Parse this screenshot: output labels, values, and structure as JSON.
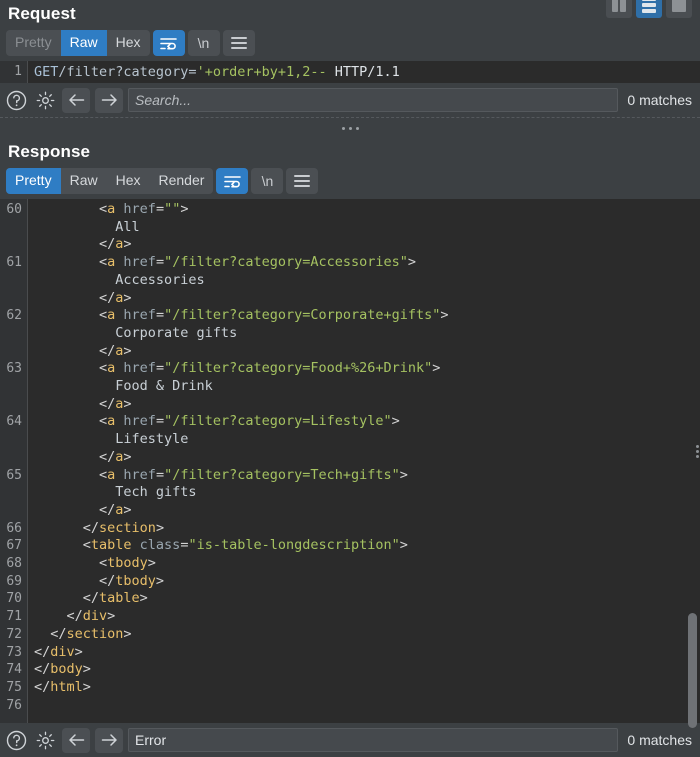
{
  "window": {
    "layout_buttons": [
      {
        "name": "layout-side-by-side",
        "icon": "columns-icon",
        "active": false
      },
      {
        "name": "layout-stacked",
        "icon": "rows-icon",
        "active": true
      },
      {
        "name": "layout-single",
        "icon": "square-icon",
        "active": false
      }
    ]
  },
  "request": {
    "title": "Request",
    "tabs": [
      {
        "label": "Pretty",
        "active": false,
        "dim": true
      },
      {
        "label": "Raw",
        "active": true,
        "dim": false
      },
      {
        "label": "Hex",
        "active": false,
        "dim": false
      }
    ],
    "wrap_icon": "word-wrap-icon",
    "newline_label": "\\n",
    "menu_icon": "hamburger-menu-icon",
    "line_number": "1",
    "line": {
      "method": "GET",
      "path": "/filter?category=",
      "payload": "'+order+by+1,2--",
      "protocol": " HTTP/1.1"
    },
    "search": {
      "help_icon": "help-circle-icon",
      "settings_icon": "gear-icon",
      "prev_icon": "arrow-left-icon",
      "next_icon": "arrow-right-icon",
      "placeholder": "Search...",
      "value": "",
      "matches": "0 matches"
    }
  },
  "response": {
    "title": "Response",
    "tabs": [
      {
        "label": "Pretty",
        "active": true,
        "dim": false
      },
      {
        "label": "Raw",
        "active": false,
        "dim": false
      },
      {
        "label": "Hex",
        "active": false,
        "dim": false
      },
      {
        "label": "Render",
        "active": false,
        "dim": false
      }
    ],
    "wrap_icon": "word-wrap-icon",
    "newline_label": "\\n",
    "menu_icon": "hamburger-menu-icon",
    "search": {
      "help_icon": "help-circle-icon",
      "settings_icon": "gear-icon",
      "prev_icon": "arrow-left-icon",
      "next_icon": "arrow-right-icon",
      "placeholder": "Search...",
      "value": "Error",
      "matches": "0 matches"
    },
    "scrollbar": {
      "thumb_top_pct": 79,
      "thumb_height_pct": 22
    },
    "code_lines": [
      {
        "num": "60",
        "tokens": [
          {
            "t": "punct",
            "v": "        <"
          },
          {
            "t": "tag",
            "v": "a"
          },
          {
            "t": "attr",
            "v": " href"
          },
          {
            "t": "punct",
            "v": "="
          },
          {
            "t": "val",
            "v": "\"\""
          },
          {
            "t": "punct",
            "v": ">"
          }
        ]
      },
      {
        "num": "",
        "tokens": [
          {
            "t": "text",
            "v": "          All"
          }
        ]
      },
      {
        "num": "",
        "tokens": [
          {
            "t": "punct",
            "v": "        </"
          },
          {
            "t": "tag",
            "v": "a"
          },
          {
            "t": "punct",
            "v": ">"
          }
        ]
      },
      {
        "num": "61",
        "tokens": [
          {
            "t": "punct",
            "v": "        <"
          },
          {
            "t": "tag",
            "v": "a"
          },
          {
            "t": "attr",
            "v": " href"
          },
          {
            "t": "punct",
            "v": "="
          },
          {
            "t": "val",
            "v": "\"/filter?category=Accessories\""
          },
          {
            "t": "punct",
            "v": ">"
          }
        ]
      },
      {
        "num": "",
        "tokens": [
          {
            "t": "text",
            "v": "          Accessories"
          }
        ]
      },
      {
        "num": "",
        "tokens": [
          {
            "t": "punct",
            "v": "        </"
          },
          {
            "t": "tag",
            "v": "a"
          },
          {
            "t": "punct",
            "v": ">"
          }
        ]
      },
      {
        "num": "62",
        "tokens": [
          {
            "t": "punct",
            "v": "        <"
          },
          {
            "t": "tag",
            "v": "a"
          },
          {
            "t": "attr",
            "v": " href"
          },
          {
            "t": "punct",
            "v": "="
          },
          {
            "t": "val",
            "v": "\"/filter?category=Corporate+gifts\""
          },
          {
            "t": "punct",
            "v": ">"
          }
        ]
      },
      {
        "num": "",
        "tokens": [
          {
            "t": "text",
            "v": "          Corporate gifts"
          }
        ]
      },
      {
        "num": "",
        "tokens": [
          {
            "t": "punct",
            "v": "        </"
          },
          {
            "t": "tag",
            "v": "a"
          },
          {
            "t": "punct",
            "v": ">"
          }
        ]
      },
      {
        "num": "63",
        "tokens": [
          {
            "t": "punct",
            "v": "        <"
          },
          {
            "t": "tag",
            "v": "a"
          },
          {
            "t": "attr",
            "v": " href"
          },
          {
            "t": "punct",
            "v": "="
          },
          {
            "t": "val",
            "v": "\"/filter?category=Food+%26+Drink\""
          },
          {
            "t": "punct",
            "v": ">"
          }
        ]
      },
      {
        "num": "",
        "tokens": [
          {
            "t": "text",
            "v": "          Food & Drink"
          }
        ]
      },
      {
        "num": "",
        "tokens": [
          {
            "t": "punct",
            "v": "        </"
          },
          {
            "t": "tag",
            "v": "a"
          },
          {
            "t": "punct",
            "v": ">"
          }
        ]
      },
      {
        "num": "64",
        "tokens": [
          {
            "t": "punct",
            "v": "        <"
          },
          {
            "t": "tag",
            "v": "a"
          },
          {
            "t": "attr",
            "v": " href"
          },
          {
            "t": "punct",
            "v": "="
          },
          {
            "t": "val",
            "v": "\"/filter?category=Lifestyle\""
          },
          {
            "t": "punct",
            "v": ">"
          }
        ]
      },
      {
        "num": "",
        "tokens": [
          {
            "t": "text",
            "v": "          Lifestyle"
          }
        ]
      },
      {
        "num": "",
        "tokens": [
          {
            "t": "punct",
            "v": "        </"
          },
          {
            "t": "tag",
            "v": "a"
          },
          {
            "t": "punct",
            "v": ">"
          }
        ]
      },
      {
        "num": "65",
        "tokens": [
          {
            "t": "punct",
            "v": "        <"
          },
          {
            "t": "tag",
            "v": "a"
          },
          {
            "t": "attr",
            "v": " href"
          },
          {
            "t": "punct",
            "v": "="
          },
          {
            "t": "val",
            "v": "\"/filter?category=Tech+gifts\""
          },
          {
            "t": "punct",
            "v": ">"
          }
        ]
      },
      {
        "num": "",
        "tokens": [
          {
            "t": "text",
            "v": "          Tech gifts"
          }
        ]
      },
      {
        "num": "",
        "tokens": [
          {
            "t": "punct",
            "v": "        </"
          },
          {
            "t": "tag",
            "v": "a"
          },
          {
            "t": "punct",
            "v": ">"
          }
        ]
      },
      {
        "num": "66",
        "tokens": [
          {
            "t": "punct",
            "v": "      </"
          },
          {
            "t": "tag",
            "v": "section"
          },
          {
            "t": "punct",
            "v": ">"
          }
        ]
      },
      {
        "num": "67",
        "tokens": [
          {
            "t": "punct",
            "v": "      <"
          },
          {
            "t": "tag",
            "v": "table"
          },
          {
            "t": "attr",
            "v": " class"
          },
          {
            "t": "punct",
            "v": "="
          },
          {
            "t": "val",
            "v": "\"is-table-longdescription\""
          },
          {
            "t": "punct",
            "v": ">"
          }
        ]
      },
      {
        "num": "68",
        "tokens": [
          {
            "t": "punct",
            "v": "        <"
          },
          {
            "t": "tag",
            "v": "tbody"
          },
          {
            "t": "punct",
            "v": ">"
          }
        ]
      },
      {
        "num": "69",
        "tokens": [
          {
            "t": "punct",
            "v": "        </"
          },
          {
            "t": "tag",
            "v": "tbody"
          },
          {
            "t": "punct",
            "v": ">"
          }
        ]
      },
      {
        "num": "70",
        "tokens": [
          {
            "t": "punct",
            "v": "      </"
          },
          {
            "t": "tag",
            "v": "table"
          },
          {
            "t": "punct",
            "v": ">"
          }
        ]
      },
      {
        "num": "71",
        "tokens": [
          {
            "t": "punct",
            "v": "    </"
          },
          {
            "t": "tag",
            "v": "div"
          },
          {
            "t": "punct",
            "v": ">"
          }
        ]
      },
      {
        "num": "72",
        "tokens": [
          {
            "t": "punct",
            "v": "  </"
          },
          {
            "t": "tag",
            "v": "section"
          },
          {
            "t": "punct",
            "v": ">"
          }
        ]
      },
      {
        "num": "73",
        "tokens": [
          {
            "t": "punct",
            "v": "</"
          },
          {
            "t": "tag",
            "v": "div"
          },
          {
            "t": "punct",
            "v": ">"
          }
        ]
      },
      {
        "num": "74",
        "tokens": [
          {
            "t": "punct",
            "v": "</"
          },
          {
            "t": "tag",
            "v": "body"
          },
          {
            "t": "punct",
            "v": ">"
          }
        ]
      },
      {
        "num": "75",
        "tokens": [
          {
            "t": "punct",
            "v": "</"
          },
          {
            "t": "tag",
            "v": "html"
          },
          {
            "t": "punct",
            "v": ">"
          }
        ]
      },
      {
        "num": "76",
        "tokens": []
      }
    ]
  },
  "colors": {
    "accent": "#2f7dc4",
    "editor_bg": "#2b2b2b",
    "chrome_bg": "#3c4043",
    "tag": "#e8bf6a",
    "value": "#a5c261",
    "attr": "#9aa7b0"
  }
}
